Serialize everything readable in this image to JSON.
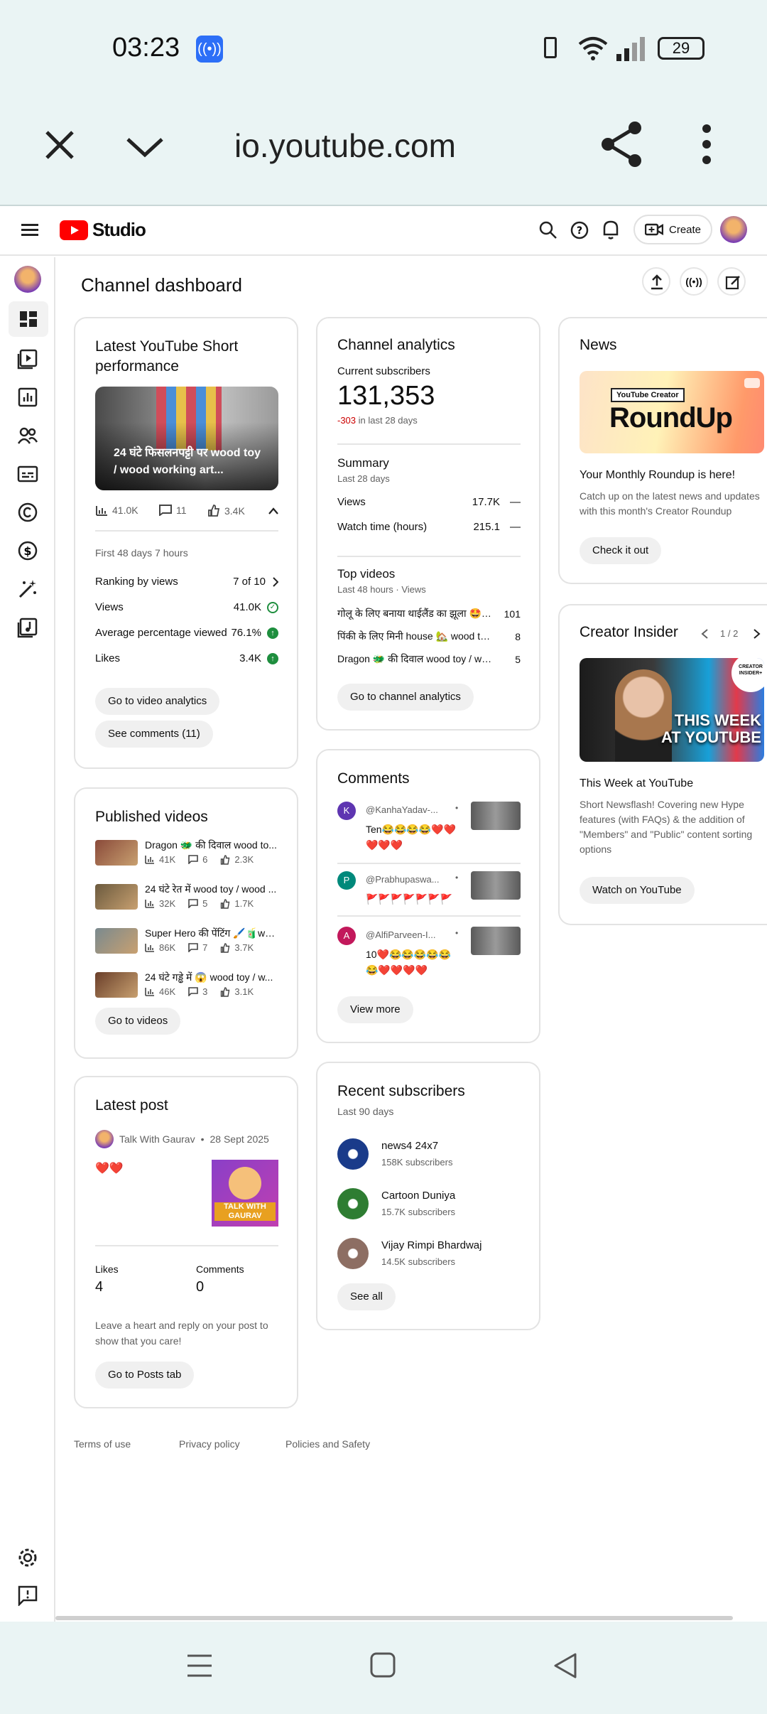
{
  "status": {
    "time": "03:23",
    "battery": "29"
  },
  "browser": {
    "url": "io.youtube.com"
  },
  "header": {
    "brand": "Studio",
    "create_label": "Create"
  },
  "page_title": "Channel dashboard",
  "short_card": {
    "title": "Latest YouTube Short performance",
    "thumb_caption": "24 घंटे फिसलनपट्टी पर wood toy / wood working art...",
    "views": "41.0K",
    "comments": "11",
    "likes": "3.4K",
    "period": "First 48 days 7 hours",
    "rows": [
      {
        "label": "Ranking by views",
        "value": "7 of 10"
      },
      {
        "label": "Views",
        "value": "41.0K"
      },
      {
        "label": "Average percentage viewed",
        "value": "76.1%"
      },
      {
        "label": "Likes",
        "value": "3.4K"
      }
    ],
    "btn_analytics": "Go to video analytics",
    "btn_comments": "See comments (11)"
  },
  "published": {
    "title": "Published videos",
    "items": [
      {
        "title": "Dragon 🐲 की दिवाल wood to...",
        "views": "41K",
        "comments": "6",
        "likes": "2.3K",
        "thumb": "#8a4a3a"
      },
      {
        "title": "24 घंटे रेत में wood toy / wood ...",
        "views": "32K",
        "comments": "5",
        "likes": "1.7K",
        "thumb": "#6b5a3e"
      },
      {
        "title": "Super Hero की पेंटिंग 🖌️🧃wo...",
        "views": "86K",
        "comments": "7",
        "likes": "3.7K",
        "thumb": "#7a8a8f"
      },
      {
        "title": "24 घंटे गड्ढे में 😱 wood toy / w...",
        "views": "46K",
        "comments": "3",
        "likes": "3.1K",
        "thumb": "#6a3f2a"
      }
    ],
    "btn": "Go to videos"
  },
  "latest_post": {
    "title": "Latest post",
    "author": "Talk With Gaurav",
    "date": "28 Sept 2025",
    "body": "❤️❤️",
    "image_text": "TALK WITH GAURAV",
    "likes_label": "Likes",
    "likes": "4",
    "comments_label": "Comments",
    "comments": "0",
    "hint": "Leave a heart and reply on your post to show that you care!",
    "btn": "Go to Posts tab"
  },
  "analytics": {
    "title": "Channel analytics",
    "subs_label": "Current subscribers",
    "subs": "131,353",
    "subs_change": "-303",
    "subs_change_suffix": " in last 28 days",
    "summary_title": "Summary",
    "summary_period": "Last 28 days",
    "summary_rows": [
      {
        "label": "Views",
        "value": "17.7K",
        "trend": "—"
      },
      {
        "label": "Watch time (hours)",
        "value": "215.1",
        "trend": "—"
      }
    ],
    "top_title": "Top videos",
    "top_period": "Last 48 hours · Views",
    "top_rows": [
      {
        "label": "गोलू के लिए बनाया थाईलैंड का झूला 🤩wo...",
        "value": "101"
      },
      {
        "label": "पिंकी के लिए मिनी house 🏡 wood toy...",
        "value": "8"
      },
      {
        "label": "Dragon 🐲 की दिवाल wood toy / wood...",
        "value": "5"
      }
    ],
    "btn": "Go to channel analytics"
  },
  "comments": {
    "title": "Comments",
    "items": [
      {
        "initial": "K",
        "color": "#5e35b1",
        "author": "@KanhaYadav-...",
        "text": "Ten😂😂😂😂❤️❤️❤️❤️❤️"
      },
      {
        "initial": "P",
        "color": "#00897b",
        "author": "@Prabhupaswa...",
        "text": "🚩🚩🚩🚩🚩🚩🚩"
      },
      {
        "initial": "A",
        "color": "#c2185b",
        "author": "@AlfiParveen-I...",
        "text": "10❤️😂😂😂😂😂😂❤️❤️❤️❤️"
      }
    ],
    "btn": "View more"
  },
  "recent_subs": {
    "title": "Recent subscribers",
    "period": "Last 90 days",
    "items": [
      {
        "name": "news4 24x7",
        "subs": "158K subscribers",
        "color": "#1a3b8a"
      },
      {
        "name": "Cartoon Duniya",
        "subs": "15.7K subscribers",
        "color": "#2e7d32"
      },
      {
        "name": "Vijay Rimpi Bhardwaj",
        "subs": "14.5K subscribers",
        "color": "#8d6e63"
      }
    ],
    "btn": "See all"
  },
  "news": {
    "title": "News",
    "banner_badge": "YouTube Creator",
    "banner_text": "RoundUp",
    "headline": "Your Monthly Roundup is here!",
    "desc": "Catch up on the latest news and updates with this month's Creator Roundup",
    "btn": "Check it out"
  },
  "insider": {
    "title": "Creator Insider",
    "pager": "1 / 2",
    "thumb_text": "THIS WEEK AT YOUTUBE",
    "badge": "CREATOR INSIDER+",
    "headline": "This Week at YouTube",
    "desc": "Short Newsflash! Covering new Hype features (with FAQs) & the addition of \"Members\" and \"Public\" content sorting options",
    "btn": "Watch on YouTube"
  },
  "footer": {
    "terms": "Terms of use",
    "privacy": "Privacy policy",
    "policies": "Policies and Safety"
  },
  "colors": {
    "yt_red": "#ff0000",
    "accent_green": "#1e8e3e",
    "sub_drop": "#cc0000"
  }
}
